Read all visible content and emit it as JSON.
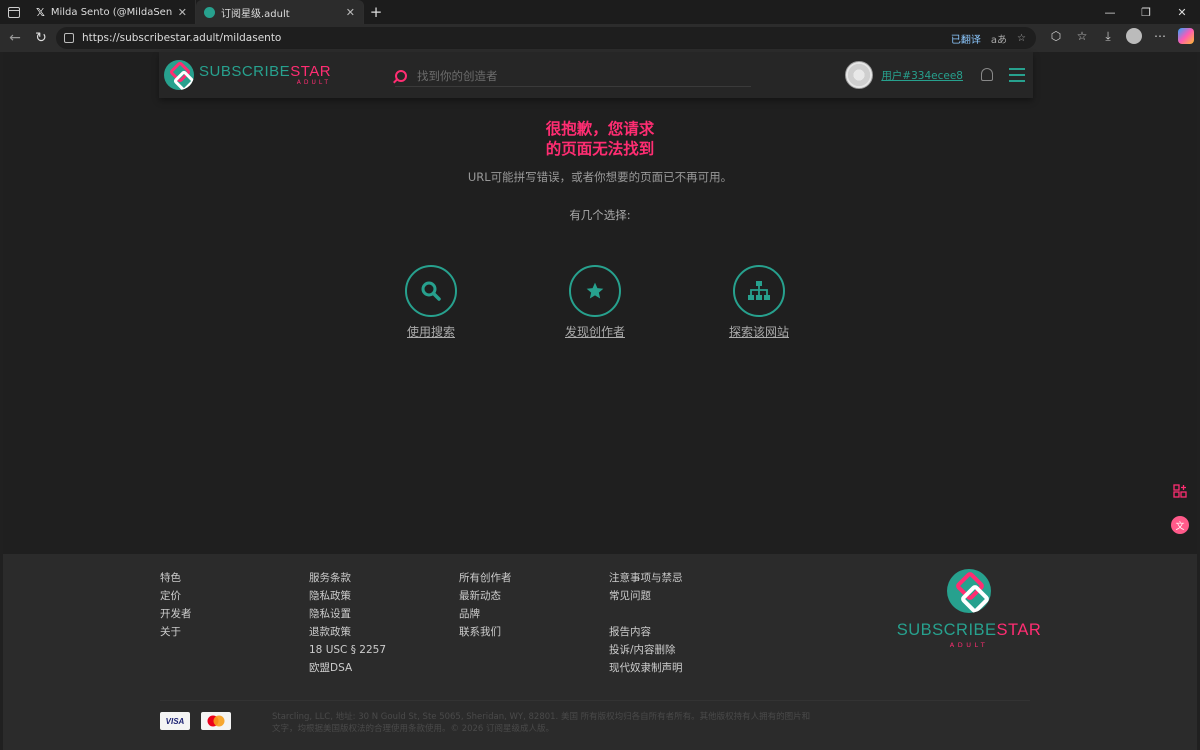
{
  "browser": {
    "tabs": [
      {
        "title": "Milda Sento (@MildaSento) / X",
        "icon": "x-logo-icon"
      },
      {
        "title": "订阅星级.adult",
        "icon": "subscribestar-favicon-icon"
      }
    ],
    "url": "https://subscribestar.adult/mildasento",
    "translate_label": "已翻译",
    "translate_icon_text": "aあ"
  },
  "header": {
    "logo_main_a": "SUBSCRIBE",
    "logo_main_b": "STAR",
    "logo_sub": "ADULT",
    "search_placeholder": "找到你的创造者",
    "username": "用户#334ecee8"
  },
  "error": {
    "title_line1": "很抱歉，您请求",
    "title_line2": "的页面无法找到",
    "description": "URL可能拼写错误，或者你想要的页面已不再可用。",
    "options_heading": "有几个选择:",
    "options": [
      {
        "label": "使用搜索",
        "icon": "search-icon"
      },
      {
        "label": "发现创作者",
        "icon": "star-icon"
      },
      {
        "label": "探索该网站",
        "icon": "sitemap-icon"
      }
    ]
  },
  "footer": {
    "col1": [
      "特色",
      "定价",
      "开发者",
      "关于"
    ],
    "col2": [
      "服务条款",
      "隐私政策",
      "隐私设置",
      "退款政策",
      "18 USC § 2257",
      "欧盟DSA"
    ],
    "col3": [
      "所有创作者",
      "最新动态",
      "品牌",
      "联系我们"
    ],
    "col4a": [
      "注意事项与禁忌",
      "常见问题"
    ],
    "col4b": [
      "报告内容",
      "投诉/内容删除",
      "现代奴隶制声明"
    ],
    "logo_main_a": "SUBSCRIBE",
    "logo_main_b": "STAR",
    "logo_sub": "ADULT",
    "card_visa": "VISA",
    "copyright": "Starcling, LLC, 地址: 30 N Gould St, Ste 5065, Sheridan, WY, 82801. 美国 所有版权均归各自所有者所有。其他版权持有人拥有的图片和文字，均根据美国版权法的合理使用条款使用。© 2026 订阅星级成人版。"
  },
  "colors": {
    "teal": "#27a18e",
    "pink": "#ff2d72"
  }
}
